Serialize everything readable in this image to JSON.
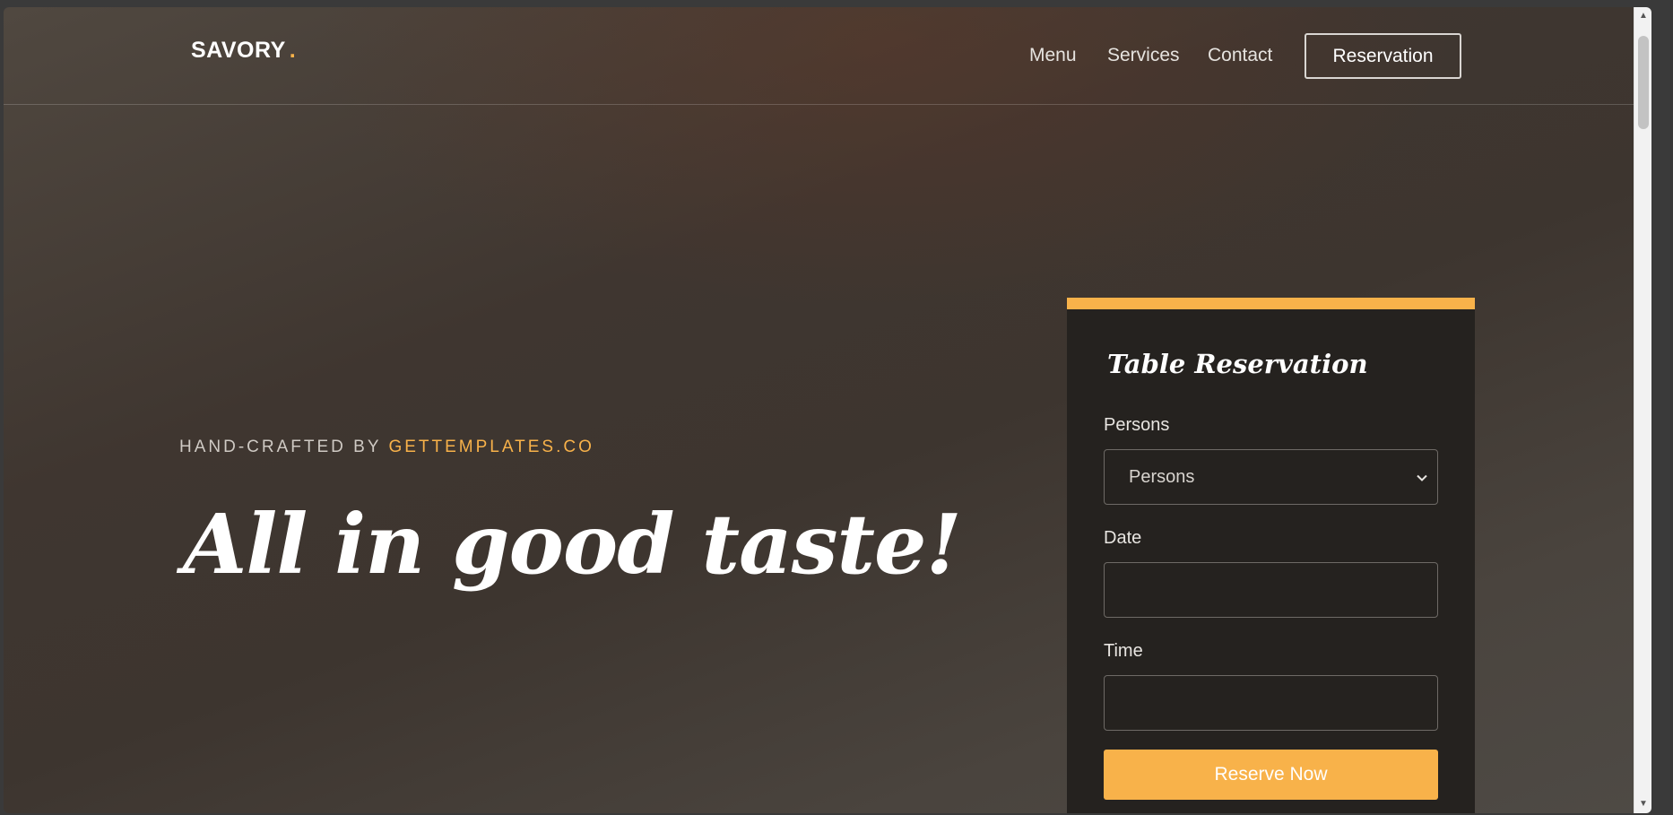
{
  "colors": {
    "accent": "#f8b24a",
    "card_background": "#25221f",
    "text_primary": "#ffffff"
  },
  "nav": {
    "brand": "SAVORY",
    "brand_dot": ".",
    "links": [
      "Menu",
      "Services",
      "Contact"
    ],
    "reservation_button": "Reservation"
  },
  "hero": {
    "kicker_prefix": "HAND-CRAFTED BY ",
    "kicker_accent": "GETTEMPLATES.CO",
    "headline": "All in good taste!"
  },
  "reservation": {
    "title": "Table Reservation",
    "persons_label": "Persons",
    "persons_value": "Persons",
    "date_label": "Date",
    "date_value": "",
    "time_label": "Time",
    "time_value": "",
    "submit_label": "Reserve Now"
  },
  "icons": {
    "select_caret": "chevron-down-icon",
    "scroll_up": "scroll-up-arrow-icon",
    "scroll_down": "scroll-down-arrow-icon"
  }
}
